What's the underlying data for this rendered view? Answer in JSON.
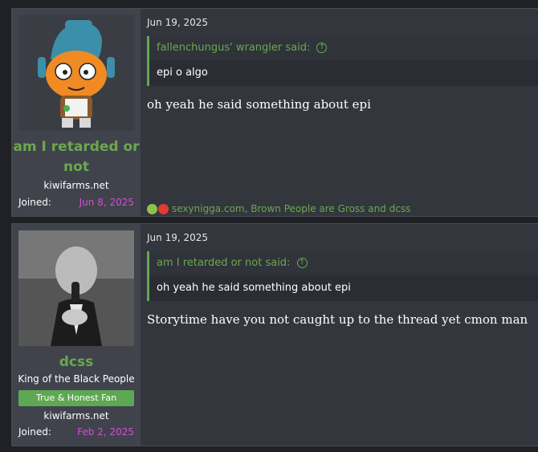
{
  "posts": [
    {
      "user": {
        "name": "am I retarded or not",
        "site": "kiwifarms.net",
        "joined_label": "Joined:",
        "joined_date": "Jun 8, 2025"
      },
      "date": "Jun 19, 2025",
      "quote": {
        "author": "fallenchungus' wrangler said:",
        "text": "epi o algo"
      },
      "message": "oh yeah he said something about epi",
      "reactions": "sexynigga.com, Brown People are Gross and dcss"
    },
    {
      "user": {
        "name": "dcss",
        "title": "King of the Black People",
        "badge": "True & Honest Fan",
        "site": "kiwifarms.net",
        "joined_label": "Joined:",
        "joined_date": "Feb 2, 2025"
      },
      "date": "Jun 19, 2025",
      "quote": {
        "author": "am I retarded or not said:",
        "text": "oh yeah he said something about epi"
      },
      "message": "Storytime have you not caught up to the thread yet cmon man"
    }
  ],
  "colors": {
    "username": "#6aa84f",
    "joined_date": "#d24fd6",
    "badge": "#5fa853"
  }
}
